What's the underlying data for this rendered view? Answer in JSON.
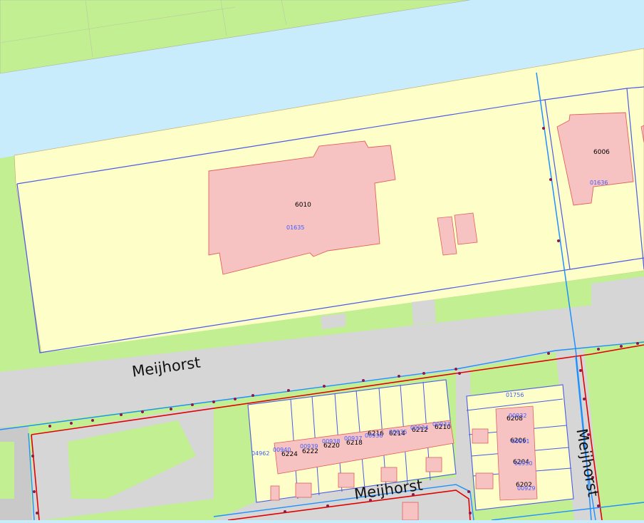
{
  "colors": {
    "water": "#c8ecfb",
    "grass": "#c2ef92",
    "parcel": "#feffc8",
    "building": "#f6c2c2",
    "building_stroke": "#e26060",
    "road": "#d6d6d6",
    "parcel_line": "#4a5ae6",
    "utility_blue": "#1e90ff",
    "utility_red": "#e30000",
    "utility_node": "#8b1a4a",
    "label_blue": "#3f5cff"
  },
  "streets": [
    {
      "label": "Meijhorst"
    },
    {
      "label": "Meijhorst"
    },
    {
      "label": "Meijhorst"
    }
  ],
  "house_numbers": [
    "6010",
    "6006",
    "6224",
    "6222",
    "6220",
    "6218",
    "6216",
    "6214",
    "6212",
    "6210",
    "6208",
    "6206",
    "6204",
    "6202"
  ],
  "parcel_ids": [
    "01635",
    "01636",
    "01756",
    "04962",
    "00940",
    "00939",
    "00938",
    "00937",
    "00936",
    "00935",
    "00934",
    "00933",
    "00932",
    "00931",
    "00930",
    "00929"
  ]
}
